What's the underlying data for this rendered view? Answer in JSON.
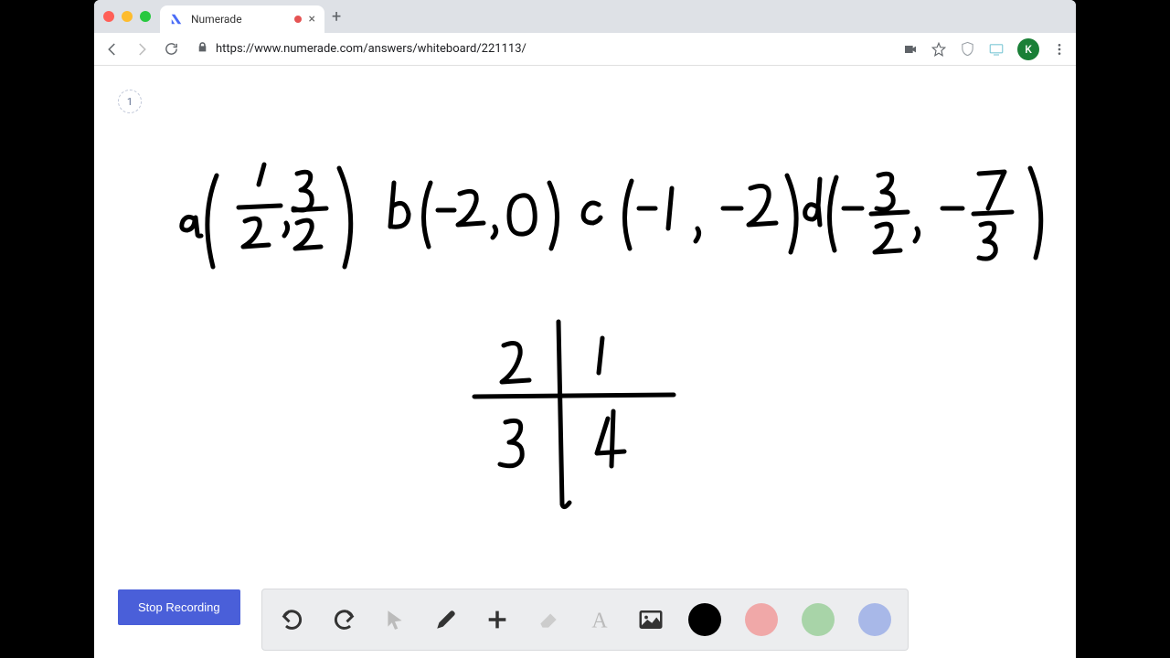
{
  "tab": {
    "title": "Numerade",
    "close": "×"
  },
  "new_tab": "+",
  "url": "https://www.numerade.com/answers/whiteboard/221113/",
  "avatar_letter": "K",
  "page_number": "1",
  "stop_recording_label": "Stop Recording",
  "whiteboard": {
    "points": {
      "a": "(1/2, 3/2)",
      "b": "(-2, 0)",
      "c": "(-1, -2)",
      "d": "(-3/2, -7/3)"
    },
    "quadrants": {
      "q1": "1",
      "q2": "2",
      "q3": "3",
      "q4": "4"
    }
  },
  "toolbar": {
    "tools": [
      "undo",
      "redo",
      "pointer",
      "pen",
      "add",
      "eraser",
      "text",
      "image"
    ],
    "colors": [
      "black",
      "red",
      "green",
      "blue"
    ]
  }
}
